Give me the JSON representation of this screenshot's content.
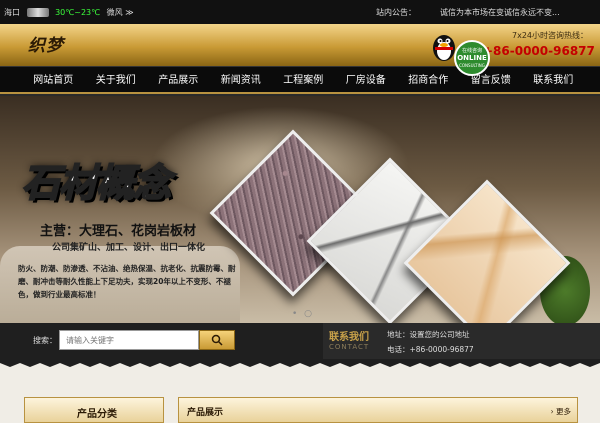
{
  "topbar": {
    "left_items": [
      "海口",
      "30℃~23℃",
      "微风 ≫"
    ],
    "notice_label": "站内公告：",
    "notice_text": "诚信为本市场在变诚信永远不变..."
  },
  "header": {
    "brand": "织梦",
    "online_en": "ONLINE",
    "online_cn": "在线咨询",
    "online_sub": "CONSULTING",
    "hotline_label": "7x24小时咨询热线：",
    "hotline_number": "+86-0000-96877"
  },
  "nav": {
    "items": [
      "网站首页",
      "关于我们",
      "产品展示",
      "新闻资讯",
      "工程案例",
      "厂房设备",
      "招商合作",
      "留言反馈",
      "联系我们"
    ]
  },
  "banner": {
    "title": "石材概念",
    "subtitle": "主营：大理石、花岗岩板材",
    "line2": "公司集矿山、加工、设计、出口一体化",
    "features": "防火、防潮、防渗透、不沾油、绝热保温、抗老化、抗震防霉、耐磨、耐冲击等耐久性能上下足功夫，实现20年以上不变形、不褪色，做到行业最高标准！",
    "dots": "• ○"
  },
  "search": {
    "label": "搜索：",
    "placeholder": "请输入关键字"
  },
  "contact": {
    "title": "联系我们",
    "title_en": "CONTACT",
    "address": "地址：设置您的公司地址",
    "tel": "电话：+86-0000-96877"
  },
  "sections": {
    "product_category": "产品分类",
    "product_show": "产品展示",
    "more": "更多"
  }
}
